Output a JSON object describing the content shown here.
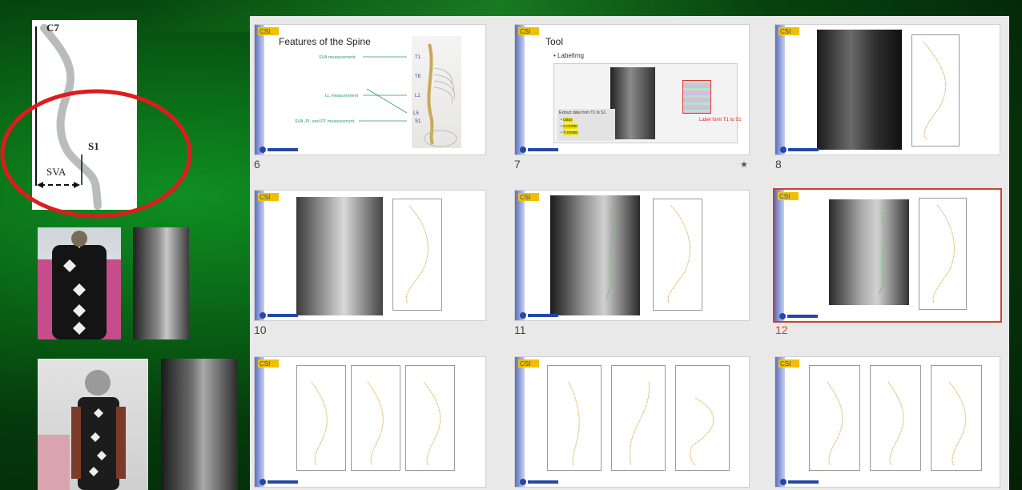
{
  "left_panel": {
    "c7_label": "C7",
    "s1_label": "S1",
    "sva_label": "SVA"
  },
  "slides": [
    {
      "number": "6",
      "title": "Features of the Spine",
      "annotations": [
        "SVA measurement",
        "LL measurement",
        "SVA ,PI, and PT measurement"
      ],
      "spine_labels": [
        "T1",
        "T8",
        "L1",
        "L5",
        "S1"
      ]
    },
    {
      "number": "7",
      "title": "Tool",
      "bullet": "LabelImg",
      "box_title": "Extract data from T1 to S1",
      "box_items": [
        "class",
        "x-center",
        "Y-center"
      ],
      "red_label": "Label form T1 to S1",
      "has_star": true
    },
    {
      "number": "8"
    },
    {
      "number": "10"
    },
    {
      "number": "11"
    },
    {
      "number": "12",
      "selected": true
    },
    {
      "number": ""
    },
    {
      "number": ""
    },
    {
      "number": ""
    }
  ],
  "colors": {
    "accent_selected": "#c7432b",
    "annotation_green": "#2a9d5c",
    "ellipse_red": "#e01b1b"
  }
}
